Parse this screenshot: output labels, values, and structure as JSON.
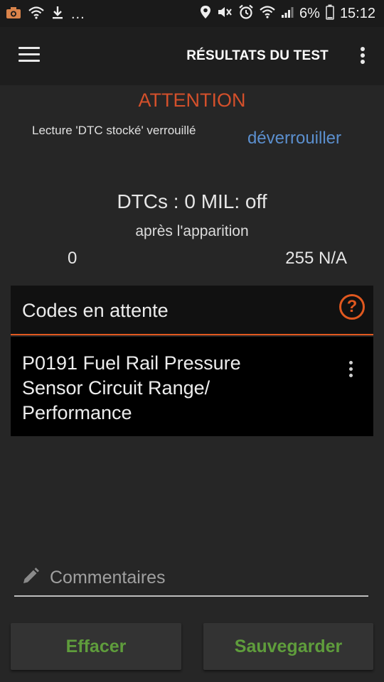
{
  "status_bar": {
    "left_icons": [
      "camera-icon",
      "wifi-icon",
      "download-icon"
    ],
    "more_indicator": "...",
    "right_icons": [
      "location-icon",
      "mute-icon",
      "alarm-icon",
      "wifi-icon",
      "signal-icon"
    ],
    "battery": "6%",
    "time": "15:12"
  },
  "app_bar": {
    "title": "RÉSULTATS DU TEST",
    "menu_icon": "hamburger-menu-icon",
    "overflow_icon": "more-vertical-icon"
  },
  "attention": {
    "heading": "ATTENTION",
    "lock_message": "Lecture 'DTC stocké' verrouillé",
    "unlock_link": "déverrouiller",
    "heading_color": "#d4502b",
    "link_color": "#5b8fce"
  },
  "summary": {
    "dtc_line": "DTCs : 0 MIL: off",
    "after_label": "après l'apparition",
    "left_value": "0",
    "right_value": "255 N/A"
  },
  "pending": {
    "title": "Codes en attente",
    "help_icon": "?",
    "accent_color": "#e0581f",
    "codes": [
      {
        "text": "P0191 Fuel Rail Pressure Sensor Circuit Range/ Performance"
      }
    ]
  },
  "comments": {
    "placeholder": "Commentaires",
    "value": ""
  },
  "actions": {
    "clear_label": "Effacer",
    "save_label": "Sauvegarder",
    "button_text_color": "#5f9d3c"
  }
}
